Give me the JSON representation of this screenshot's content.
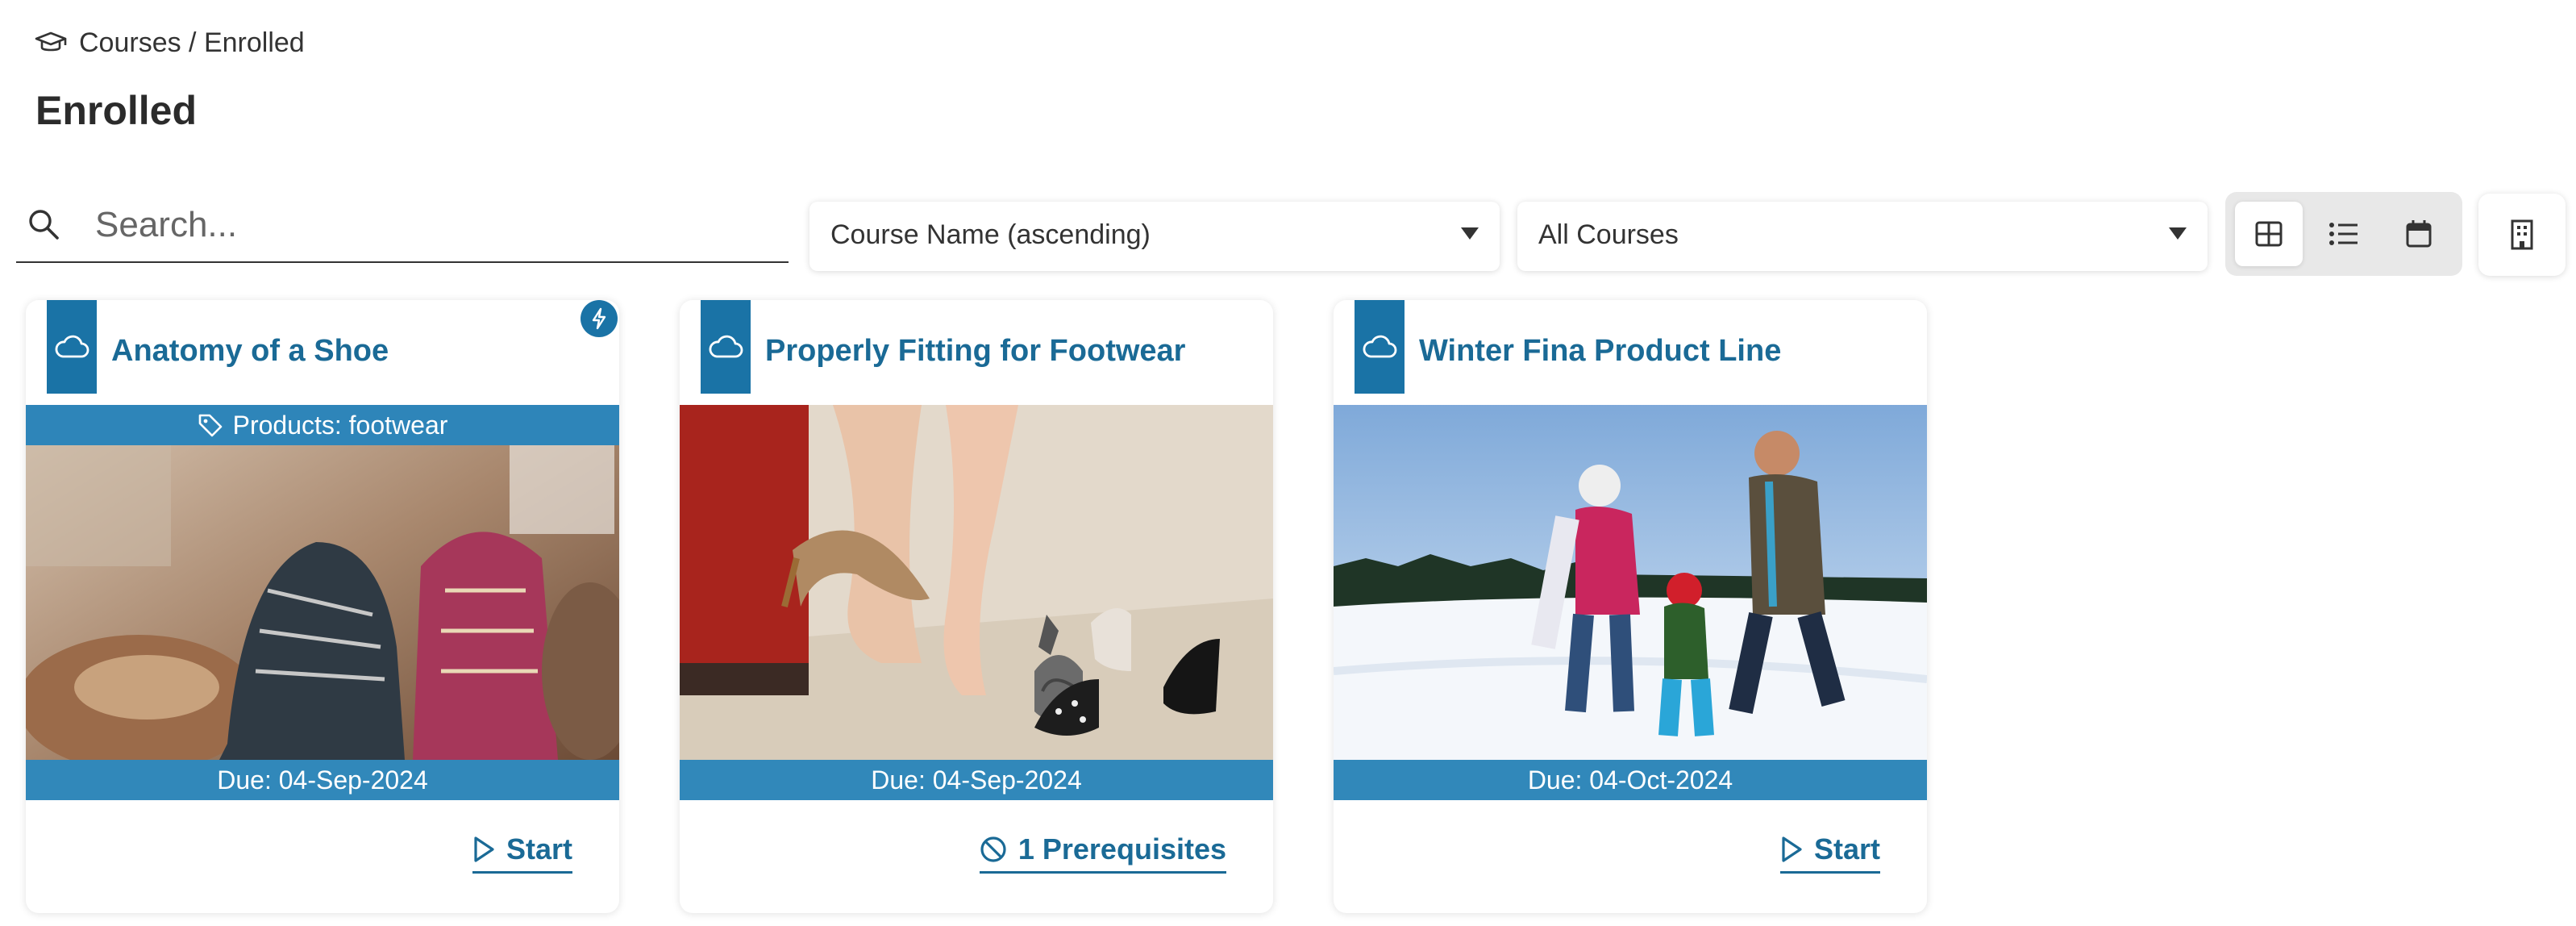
{
  "breadcrumb": {
    "icon": "graduation-cap-icon",
    "text": "Courses / Enrolled"
  },
  "page_title": "Enrolled",
  "search": {
    "placeholder": "Search...",
    "value": "",
    "icon": "search-icon"
  },
  "sort_select": {
    "value": "Course Name (ascending)"
  },
  "filter_select": {
    "value": "All Courses"
  },
  "view_toggle": {
    "options": [
      "grid-view-icon",
      "list-view-icon",
      "calendar-icon"
    ],
    "active": "grid-view-icon"
  },
  "org_button": {
    "icon": "building-icon"
  },
  "colors": {
    "accent": "#1a73a6",
    "title_text": "#1a6a96",
    "bar": "#3188ba"
  },
  "courses": [
    {
      "title": "Anatomy of a Shoe",
      "type_icon": "cloud-icon",
      "flash_icon": "lightning-icon",
      "tag": "Products: footwear",
      "image": "shoes-photo",
      "due": "Due: 04-Sep-2024",
      "action": "Start",
      "action_icon": "play-icon"
    },
    {
      "title": "Properly Fitting for Footwear",
      "type_icon": "cloud-icon",
      "tag": "",
      "image": "woman-trying-heels-photo",
      "due": "Due: 04-Sep-2024",
      "action": "1 Prerequisites",
      "action_icon": "blocked-icon"
    },
    {
      "title": "Winter Fina Product Line",
      "type_icon": "cloud-icon",
      "tag": "",
      "image": "family-in-snow-photo",
      "due": "Due: 04-Oct-2024",
      "action": "Start",
      "action_icon": "play-icon"
    }
  ]
}
